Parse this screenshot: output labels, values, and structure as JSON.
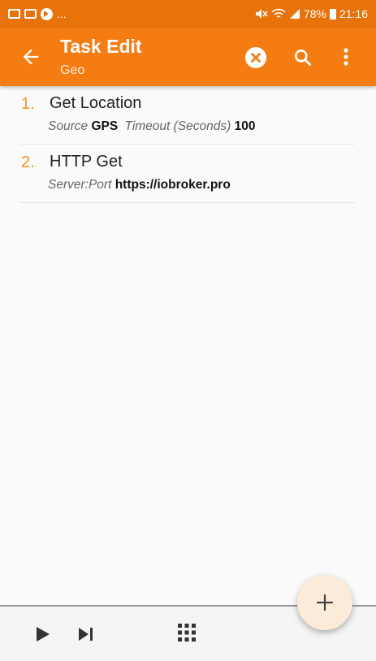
{
  "status_bar": {
    "left_overflow": "...",
    "battery_percent": "78%",
    "time": "21:16"
  },
  "toolbar": {
    "title": "Task Edit",
    "subtitle": "Geo",
    "back_icon": "arrow-left-icon",
    "clear_icon": "close-circle-icon",
    "search_icon": "search-icon",
    "menu_icon": "more-vert-icon"
  },
  "actions": [
    {
      "number": "1.",
      "name": "Get Location",
      "params": [
        {
          "label": "Source",
          "value": "GPS"
        },
        {
          "label": "Timeout (Seconds)",
          "value": "100"
        }
      ]
    },
    {
      "number": "2.",
      "name": "HTTP Get",
      "params": [
        {
          "label": "Server:Port",
          "value": "https://iobroker.pro"
        }
      ]
    }
  ],
  "bottom_bar": {
    "play_icon": "play-icon",
    "step_icon": "skip-next-icon",
    "grid_icon": "grid-icon"
  },
  "fab": {
    "label": "+",
    "icon": "add-icon"
  },
  "colors": {
    "status_bar": "#e8730b",
    "toolbar": "#f57c10",
    "accent": "#f39424"
  }
}
